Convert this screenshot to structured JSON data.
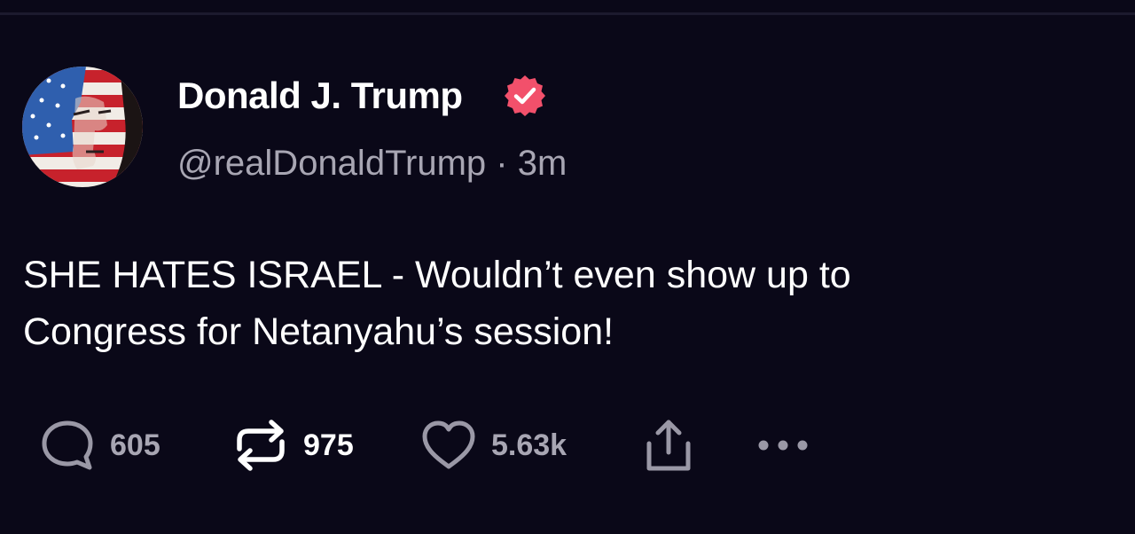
{
  "post": {
    "display_name": "Donald J. Trump",
    "handle": "@realDonaldTrump",
    "separator": "·",
    "time_ago": "3m",
    "text_line1": "SHE HATES ISRAEL - Wouldn’t even show up to",
    "text_line2": "Congress for Netanyahu’s session!"
  },
  "actions": {
    "reply_count": "605",
    "repost_count": "975",
    "like_count": "5.63k"
  },
  "icons": {
    "verified": "verified-badge-icon",
    "reply": "speech-bubble-icon",
    "repost": "repost-arrows-icon",
    "like": "heart-icon",
    "share": "share-upload-icon",
    "more": "ellipsis-icon"
  },
  "colors": {
    "background": "#0a0818",
    "verified_badge": "#f2506b",
    "muted_text": "#a8a6b3",
    "icon_gray": "#9a98a6"
  }
}
